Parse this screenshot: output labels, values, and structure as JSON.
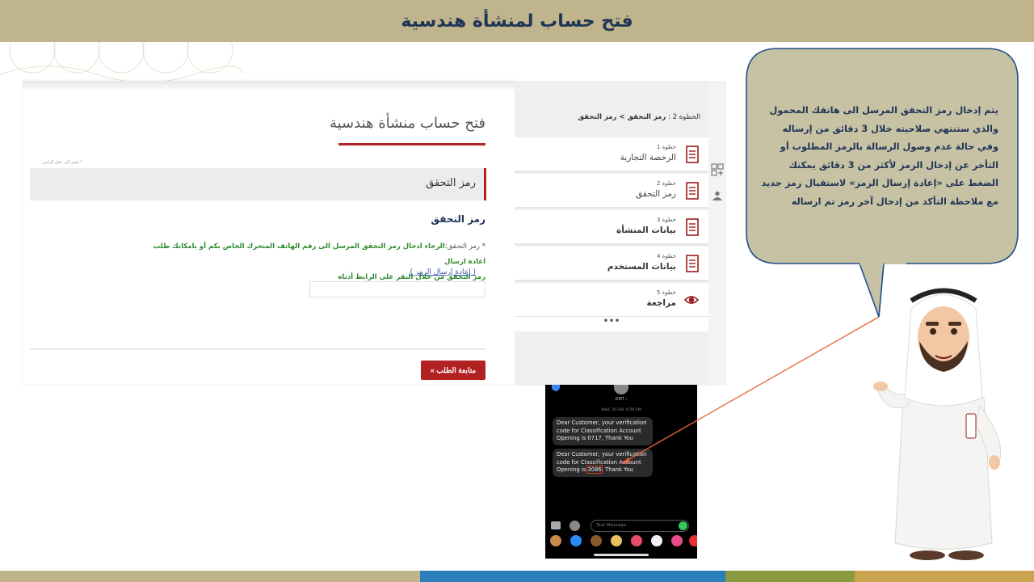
{
  "slide": {
    "title": "فتح حساب لمنشأة هندسية"
  },
  "form": {
    "title": "فتح حساب منشأة هندسية",
    "required_note": "* تشير الى حقل الزامي",
    "section_header": "رمز التحقق",
    "sub_title": "رمز التحقق",
    "instruction_label": "* رمز التحقق:",
    "instruction_line1": "الرجاء ادخال رمز التحقق المرسل الى رقم الهاتف المتحرك الخاص بكم أو بامكانك طلب اعادة ارسال",
    "instruction_line2": "رمز التحقق من خلال النقر على الرابط أدناه",
    "resend_link": "( إعادة إرسال الرمز )",
    "code_value": "",
    "continue_button": "متابعة الطلب »"
  },
  "steps": {
    "breadcrumb_prefix": "الخطوة 2 :",
    "breadcrumb_path": "رمز التحقق > رمز التحقق",
    "items": [
      {
        "num": "خطوة 1",
        "label": "الرخصة التجارية",
        "icon": "document-icon"
      },
      {
        "num": "خطوة 2",
        "label": "رمز التحقق",
        "icon": "document-icon"
      },
      {
        "num": "خطوة 3",
        "label": "بيانات المنشأة",
        "icon": "document-icon"
      },
      {
        "num": "خطوة 4",
        "label": "بيانات المستخدم",
        "icon": "document-icon"
      },
      {
        "num": "خطوة 5",
        "label": "مراجعة",
        "icon": "eye-icon"
      }
    ],
    "more": "•••"
  },
  "phone": {
    "contact": "DMT ›",
    "date": "Wed, 26 Feb, 6:59 AM",
    "message1": "Dear Customer, your verification code for Classification Account Opening is 0717, Thank You",
    "message2_before": "Dear Customer, your verification code for Classification Account Opening is ",
    "message2_code": "3086",
    "message2_after": ", Thank You",
    "input_placeholder": "Text Message"
  },
  "speech": {
    "text": "يتم إدخال رمز التحقق المرسل الى هاتفك المحمول والذي ستنتهي صلاحيته خلال 3 دقائق من إرساله وفي حالة عدم وصول الرسالة بالرمز المطلوب أو التأخر عن إدخال الرمز لأكثر من 3 دقائق يمكنك الضغط على «إعادة إرسال الرمز» لاستقبال رمز جديد مع ملاحظة التأكد من إدخال آخر رمز تم ارساله"
  },
  "colors": {
    "title_bar": "#bfb48c",
    "title_text": "#1f3556",
    "accent_red": "#b22222",
    "speech_fill": "#c8c2a4",
    "speech_border": "#1f4f8a",
    "footer": [
      "#bfb48c",
      "#2a7fb8",
      "#8a9a3f",
      "#c9a34e"
    ]
  }
}
